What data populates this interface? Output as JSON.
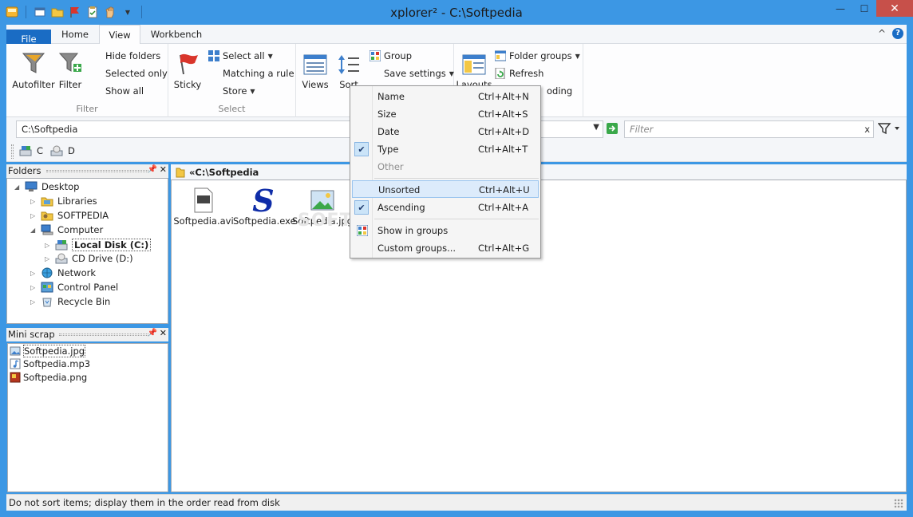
{
  "window": {
    "title": "xplorer² - C:\\Softpedia"
  },
  "quick_access": [
    "app-icon",
    "new-window-icon",
    "open-folder-icon",
    "flag-icon",
    "clipboard-icon",
    "hand-icon",
    "dropdown-icon"
  ],
  "window_controls": {
    "minimize": "—",
    "maximize": "☐",
    "close": "✕"
  },
  "tabs": [
    {
      "label": "File"
    },
    {
      "label": "Home"
    },
    {
      "label": "View"
    },
    {
      "label": "Workbench"
    }
  ],
  "tab_controls": {
    "collapse": "^",
    "help": "?"
  },
  "ribbon": {
    "filter_group": {
      "label": "Filter",
      "autofilter": "Autofilter",
      "filter": "Filter",
      "hide_folders": "Hide folders",
      "selected_only": "Selected only",
      "show_all": "Show all"
    },
    "select_group": {
      "label": "Select",
      "sticky": "Sticky",
      "select_all": "Select all",
      "matching_rule": "Matching a rule",
      "store": "Store"
    },
    "view_group": {
      "views": "Views",
      "sort": "Sort",
      "group": "Group",
      "save_settings": "Save settings"
    },
    "layout_group": {
      "layouts": "Layouts",
      "folder_groups": "Folder groups",
      "refresh": "Refresh",
      "partial_label": "oding"
    }
  },
  "address_bar": {
    "path": "C:\\Softpedia",
    "filter_placeholder": "Filter",
    "clear": "x"
  },
  "drives": [
    {
      "label": "C"
    },
    {
      "label": "D"
    }
  ],
  "folders_pane": {
    "title": "Folders",
    "nodes": [
      {
        "label": "Desktop",
        "expanded": true
      },
      {
        "label": "Libraries"
      },
      {
        "label": "SOFTPEDIA"
      },
      {
        "label": "Computer",
        "expanded": true
      },
      {
        "label": "Local Disk (C:)",
        "selected": true
      },
      {
        "label": "CD Drive (D:)"
      },
      {
        "label": "Network"
      },
      {
        "label": "Control Panel"
      },
      {
        "label": "Recycle Bin"
      }
    ]
  },
  "mini_scrap": {
    "title": "Mini scrap",
    "items": [
      {
        "label": "Softpedia.jpg"
      },
      {
        "label": "Softpedia.mp3"
      },
      {
        "label": "Softpedia.png"
      }
    ]
  },
  "main_pane": {
    "header": "«C:\\Softpedia",
    "files": [
      {
        "label": "Softpedia.avi"
      },
      {
        "label": "Softpedia.exe"
      },
      {
        "label": "Softpedia.jpg"
      }
    ],
    "watermark": "SOFTPEDIA"
  },
  "sort_menu": {
    "items": [
      {
        "label": "Name",
        "shortcut": "Ctrl+Alt+N"
      },
      {
        "label": "Size",
        "shortcut": "Ctrl+Alt+S"
      },
      {
        "label": "Date",
        "shortcut": "Ctrl+Alt+D"
      },
      {
        "label": "Type",
        "shortcut": "Ctrl+Alt+T",
        "checked": true
      },
      {
        "label": "Other",
        "shortcut": "",
        "disabled": true
      },
      {
        "label": "Unsorted",
        "shortcut": "Ctrl+Alt+U",
        "highlighted": true
      },
      {
        "label": "Ascending",
        "shortcut": "Ctrl+Alt+A",
        "checked": true
      },
      {
        "label": "Show in groups",
        "shortcut": ""
      },
      {
        "label": "Custom groups...",
        "shortcut": "Ctrl+Alt+G"
      }
    ]
  },
  "status_bar": {
    "text": "Do not sort items; display them in the order read from disk"
  },
  "colors": {
    "frame": "#3c97e4",
    "file_tab": "#1a6cc4",
    "close_button": "#c7504a",
    "highlight": "#dcebfb"
  }
}
